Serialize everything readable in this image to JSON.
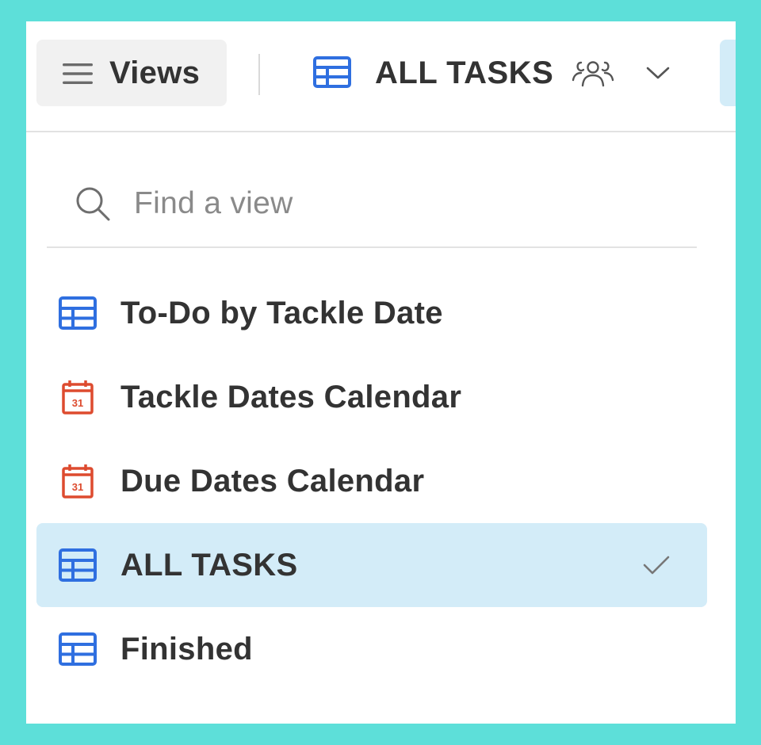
{
  "toolbar": {
    "views_label": "Views",
    "current_view": {
      "label": "ALL TASKS",
      "icon": "grid-icon",
      "shared_icon": "shared-users-icon",
      "dropdown_icon": "chevron-down-icon"
    }
  },
  "search": {
    "placeholder": "Find a view",
    "value": "",
    "icon": "search-icon"
  },
  "views": [
    {
      "label": "To-Do by Tackle Date",
      "icon": "grid-icon",
      "selected": false
    },
    {
      "label": "Tackle Dates Calendar",
      "icon": "calendar-icon",
      "calendar_day": "31",
      "selected": false
    },
    {
      "label": "Due Dates Calendar",
      "icon": "calendar-icon",
      "calendar_day": "31",
      "selected": false
    },
    {
      "label": "ALL TASKS",
      "icon": "grid-icon",
      "selected": true
    },
    {
      "label": "Finished",
      "icon": "grid-icon",
      "selected": false
    }
  ],
  "colors": {
    "background": "#5ddfd9",
    "panel": "#ffffff",
    "selected_row": "#d3ecf8",
    "grid_icon": "#2f6fe0",
    "calendar_icon": "#dd4b2f",
    "text": "#333333",
    "muted_text": "#8a8a8a"
  }
}
